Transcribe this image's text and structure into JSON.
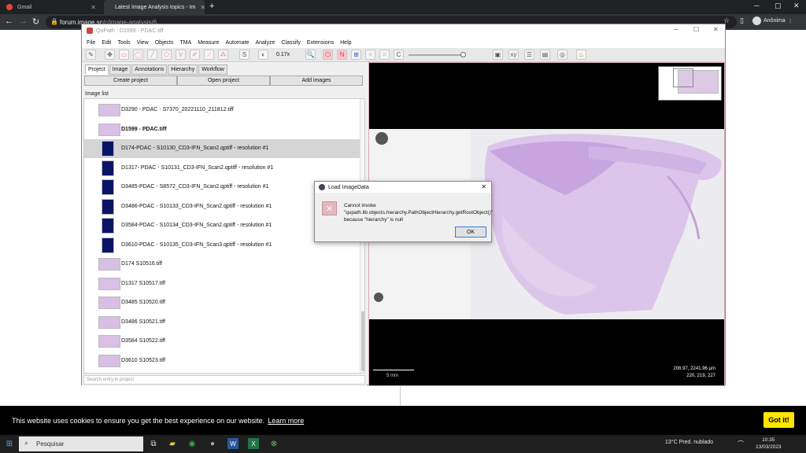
{
  "browser": {
    "tabs": [
      {
        "label": "Gmail",
        "favicon_color": "#ea4335"
      },
      {
        "label": "Latest Image Analysis topics - Im",
        "favicon_color": "#5b6ee1"
      }
    ],
    "new_tab": "+",
    "url_host": "forum.image.sc",
    "url_path": "/c/image-analysis/6",
    "profile": "Anônima"
  },
  "qupath": {
    "title": "QuPath - D1599 - PDAC.tiff",
    "menu": [
      "File",
      "Edit",
      "Tools",
      "View",
      "Objects",
      "TMA",
      "Measure",
      "Automate",
      "Analyze",
      "Classify",
      "Extensions",
      "Help"
    ],
    "zoom": "0.17x",
    "tabs": [
      "Project",
      "Image",
      "Annotations",
      "Hierarchy",
      "Workflow"
    ],
    "buttons": {
      "create_project": "Create project",
      "open_project": "Open project",
      "add_images": "Add images"
    },
    "image_list_label": "Image list",
    "images": [
      {
        "name": "D3290 - PDAC - S7370_20221110_211812.tiff",
        "thumb": "he",
        "bold": false,
        "selected": false
      },
      {
        "name": "D1599 - PDAC.tiff",
        "thumb": "he",
        "bold": true,
        "selected": false
      },
      {
        "name": "D174-PDAC - S10130_CD3-IFN_Scan2.qptiff - resolution #1",
        "thumb": "if",
        "bold": false,
        "selected": true
      },
      {
        "name": "D1317- PDAC - S10131_CD3-IFN_Scan2.qptiff - resolution #1",
        "thumb": "if",
        "bold": false,
        "selected": false
      },
      {
        "name": "D3485-PDAC - S8572_CD3-IFN_Scan2.qptiff - resolution #1",
        "thumb": "if",
        "bold": false,
        "selected": false
      },
      {
        "name": "D3486-PDAC - S10133_CD3-IFN_Scan2.qptiff - resolution #1",
        "thumb": "if",
        "bold": false,
        "selected": false
      },
      {
        "name": "D3584-PDAC - S10134_CD3-IFN_Scan2.qptiff - resolution #1",
        "thumb": "if",
        "bold": false,
        "selected": false
      },
      {
        "name": "D3610-PDAC - S10135_CD3-IFN_Scan3.qptiff - resolution #1",
        "thumb": "if",
        "bold": false,
        "selected": false
      },
      {
        "name": "D174 S10516.tiff",
        "thumb": "he",
        "bold": false,
        "selected": false
      },
      {
        "name": "D1317 S10517.tiff",
        "thumb": "he",
        "bold": false,
        "selected": false
      },
      {
        "name": "D3485 S10520.tiff",
        "thumb": "he",
        "bold": false,
        "selected": false
      },
      {
        "name": "D3486 S10521.tiff",
        "thumb": "he",
        "bold": false,
        "selected": false
      },
      {
        "name": "D3584 S10522.tiff",
        "thumb": "he",
        "bold": false,
        "selected": false
      },
      {
        "name": "D3610 S10523.tiff",
        "thumb": "he",
        "bold": false,
        "selected": false
      }
    ],
    "search_placeholder": "Search entry in project",
    "scale_label": "5 mm",
    "coords_line1": "206.97, 2241.96 µm",
    "coords_line2": "220, 219, 227"
  },
  "dialog": {
    "title": "Load ImageData",
    "message": "Cannot invoke \"qupath.lib.objects.hierarchy.PathObjectHierarchy.getRootObject()\" because \"hierarchy\" is null",
    "ok": "OK"
  },
  "cookie": {
    "text": "This website uses cookies to ensure you get the best experience on our website.",
    "learn_more": "Learn more",
    "got_it": "Got it!"
  },
  "taskbar": {
    "search": "Pesquisar",
    "weather": "13°C  Pred. nublado",
    "time": "10:35",
    "date": "13/03/2023"
  },
  "colors": {
    "he_stain": "#d9bfe6",
    "if_stain": "#0a1466",
    "accent_yellow": "#ffe600"
  }
}
